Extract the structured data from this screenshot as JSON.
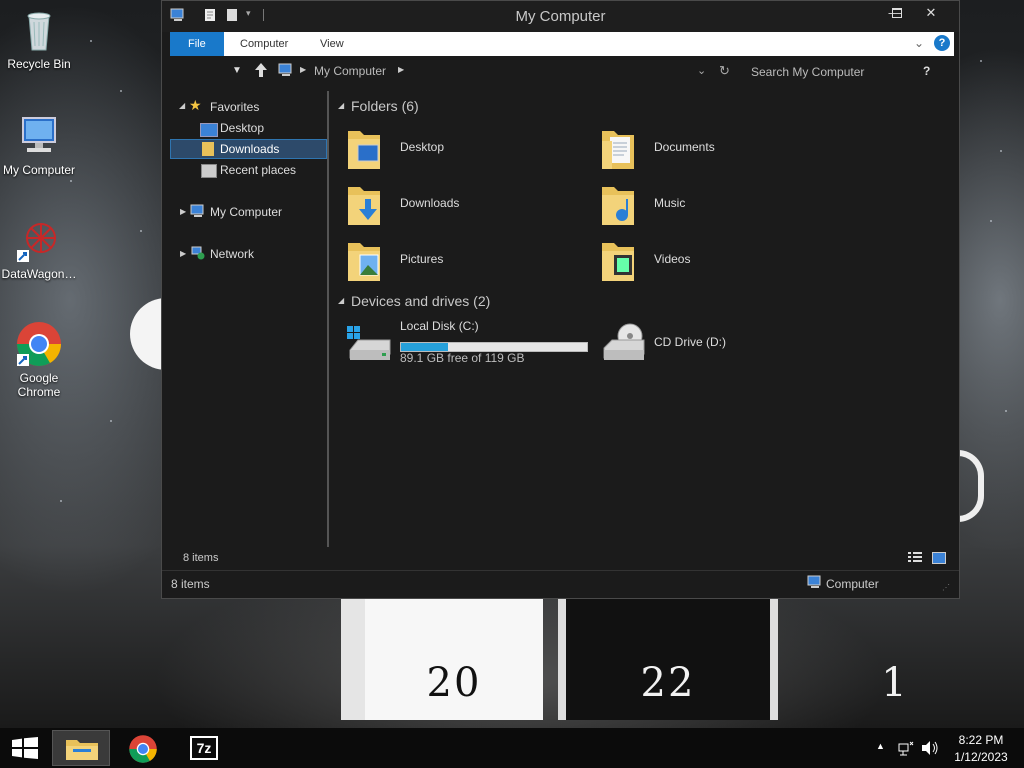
{
  "desktop": {
    "icons": [
      {
        "label": "Recycle Bin",
        "icon": "recycle-bin-icon"
      },
      {
        "label": "My Computer",
        "icon": "computer-icon"
      },
      {
        "label": "DataWagon…",
        "icon": "datawagon-icon"
      },
      {
        "label": "Google Chrome",
        "icon": "chrome-icon"
      }
    ],
    "calendar": {
      "left": "20",
      "right": "22",
      "partial": "1"
    }
  },
  "window": {
    "title": "My Computer",
    "ribbon_tabs": [
      "File",
      "Computer",
      "View"
    ],
    "address": {
      "location": "My Computer",
      "search_placeholder": "Search My Computer",
      "help": "?"
    },
    "nav": {
      "favorites": "Favorites",
      "desktop": "Desktop",
      "downloads": "Downloads",
      "recent": "Recent places",
      "my_computer": "My Computer",
      "network": "Network"
    },
    "folders_header": "Folders (6)",
    "folders": [
      {
        "name": "Desktop",
        "icon": "desktop-folder-icon"
      },
      {
        "name": "Documents",
        "icon": "documents-folder-icon"
      },
      {
        "name": "Downloads",
        "icon": "downloads-folder-icon"
      },
      {
        "name": "Music",
        "icon": "music-folder-icon"
      },
      {
        "name": "Pictures",
        "icon": "pictures-folder-icon"
      },
      {
        "name": "Videos",
        "icon": "videos-folder-icon"
      }
    ],
    "devices_header": "Devices and drives (2)",
    "drives": [
      {
        "name": "Local Disk (C:)",
        "free_text": "89.1 GB free of 119 GB",
        "used_fraction": 0.25,
        "icon": "hard-drive-icon"
      },
      {
        "name": "CD Drive (D:)",
        "icon": "cd-drive-icon"
      }
    ],
    "items_count_inner": "8 items",
    "status_items": "8 items",
    "status_location": "Computer"
  },
  "taskbar": {
    "time": "8:22 PM",
    "date": "1/12/2023",
    "apps": [
      "file-explorer-icon",
      "chrome-icon",
      "7zip-icon"
    ],
    "sevenzip_label": "7z"
  },
  "colors": {
    "accent": "#1979ca",
    "selection": "#2d4a6a",
    "drive_fill": "#26a0da",
    "folder_yellow": "#e8c15a"
  }
}
